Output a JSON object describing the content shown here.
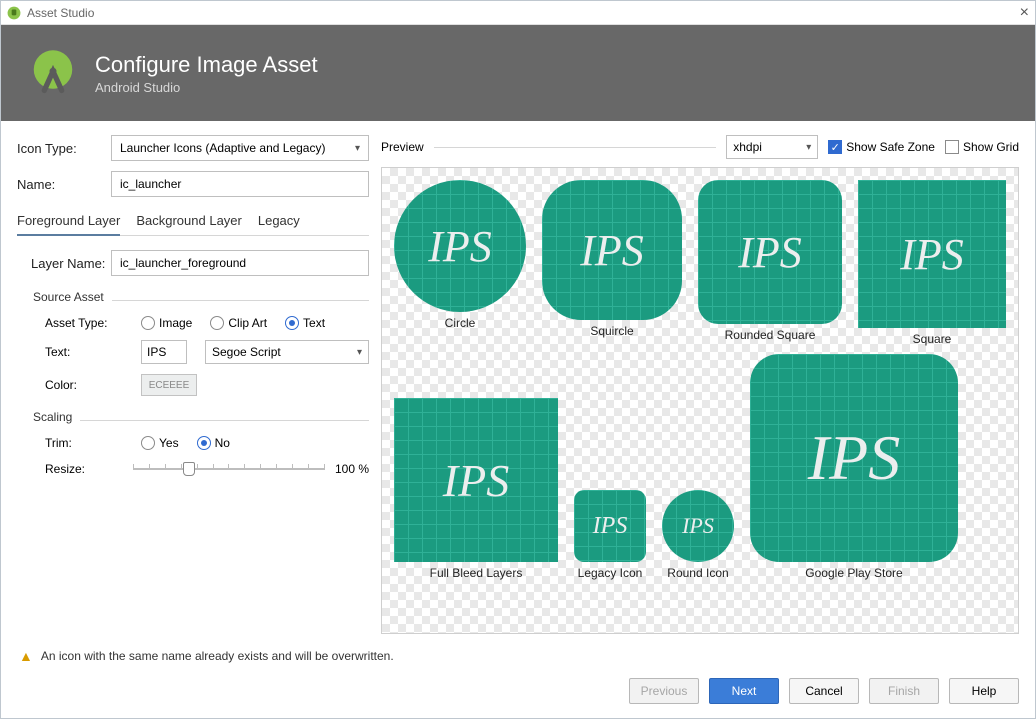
{
  "titlebar": {
    "title": "Asset Studio"
  },
  "banner": {
    "title": "Configure Image Asset",
    "subtitle": "Android Studio"
  },
  "left": {
    "icon_type_label": "Icon Type:",
    "icon_type_value": "Launcher Icons (Adaptive and Legacy)",
    "name_label": "Name:",
    "name_value": "ic_launcher",
    "tabs": {
      "fg": "Foreground Layer",
      "bg": "Background Layer",
      "legacy": "Legacy"
    },
    "layer_name_label": "Layer Name:",
    "layer_name_value": "ic_launcher_foreground",
    "source_asset_label": "Source Asset",
    "asset_type_label": "Asset Type:",
    "asset_type": {
      "image": "Image",
      "clipart": "Clip Art",
      "text": "Text"
    },
    "text_label": "Text:",
    "text_value": "IPS",
    "font_value": "Segoe Script",
    "color_label": "Color:",
    "color_hex": "ECEEEE",
    "scaling_label": "Scaling",
    "trim_label": "Trim:",
    "trim_yes": "Yes",
    "trim_no": "No",
    "resize_label": "Resize:",
    "resize_value": "100 %"
  },
  "preview": {
    "label": "Preview",
    "density": "xhdpi",
    "show_safe_zone": "Show Safe Zone",
    "show_grid": "Show Grid",
    "captions": {
      "circle": "Circle",
      "squircle": "Squircle",
      "rounded": "Rounded Square",
      "square": "Square",
      "full_bleed": "Full Bleed Layers",
      "legacy": "Legacy Icon",
      "round": "Round Icon",
      "play": "Google Play Store"
    },
    "sample_text": "IPS"
  },
  "warning": "An icon with the same name already exists and will be overwritten.",
  "buttons": {
    "previous": "Previous",
    "next": "Next",
    "cancel": "Cancel",
    "finish": "Finish",
    "help": "Help"
  }
}
